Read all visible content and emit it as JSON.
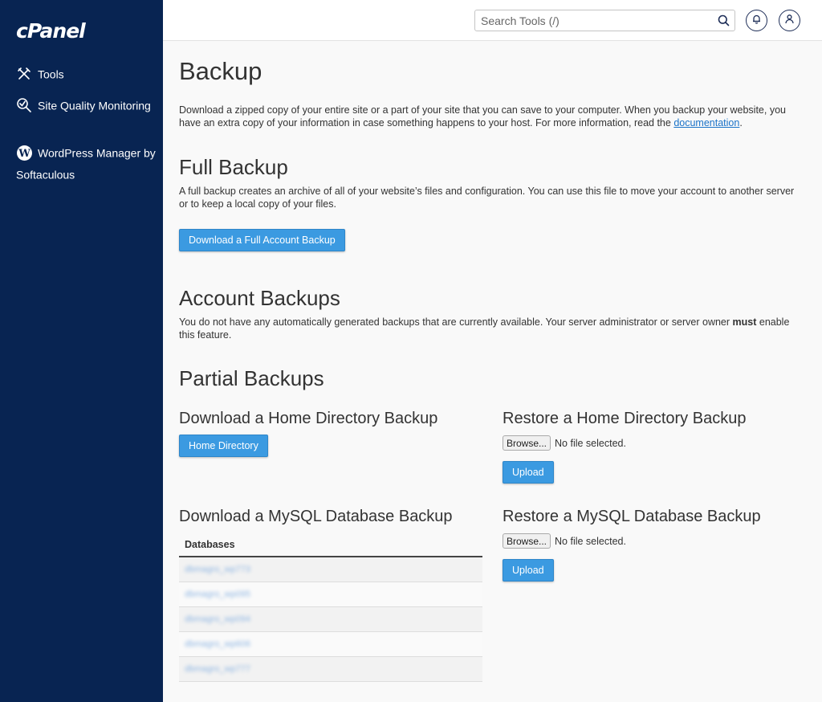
{
  "sidebar": {
    "logo": "cPanel",
    "items": [
      {
        "label": "Tools",
        "icon": "tools-icon"
      },
      {
        "label": "Site Quality Monitoring",
        "icon": "search-quality-icon"
      },
      {
        "label": "WordPress Manager by Softaculous",
        "icon": "wordpress-icon"
      }
    ]
  },
  "header": {
    "search_placeholder": "Search Tools (/)",
    "icons": [
      "search-icon",
      "bell-icon",
      "user-icon"
    ]
  },
  "page": {
    "title": "Backup",
    "intro_text": "Download a zipped copy of your entire site or a part of your site that you can save to your computer. When you backup your website, you have an extra copy of your information in case something happens to your host. For more information, read the ",
    "intro_link": "documentation",
    "intro_end": "."
  },
  "full_backup": {
    "title": "Full Backup",
    "text": "A full backup creates an archive of all of your website’s files and configuration. You can use this file to move your account to another server or to keep a local copy of your files.",
    "button": "Download a Full Account Backup"
  },
  "account_backups": {
    "title": "Account Backups",
    "text_before": "You do not have any automatically generated backups that are currently available. Your server administrator or server owner ",
    "text_bold": "must",
    "text_after": " enable this feature."
  },
  "partial_backups": {
    "title": "Partial Backups",
    "home_download": {
      "title": "Download a Home Directory Backup",
      "button": "Home Directory"
    },
    "home_restore": {
      "title": "Restore a Home Directory Backup",
      "browse": "Browse...",
      "file_status": "No file selected.",
      "button": "Upload"
    },
    "mysql_download": {
      "title": "Download a MySQL Database Backup",
      "column": "Databases",
      "rows": [
        "dbmagro_wp773",
        "dbmagro_wp095",
        "dbmagro_wp094",
        "dbmagro_wp606",
        "dbmagro_wp777"
      ]
    },
    "mysql_restore": {
      "title": "Restore a MySQL Database Backup",
      "browse": "Browse...",
      "file_status": "No file selected.",
      "button": "Upload"
    }
  },
  "colors": {
    "sidebar_bg": "#082452",
    "primary_button": "#3b9ae1",
    "link": "#1a73c8"
  }
}
